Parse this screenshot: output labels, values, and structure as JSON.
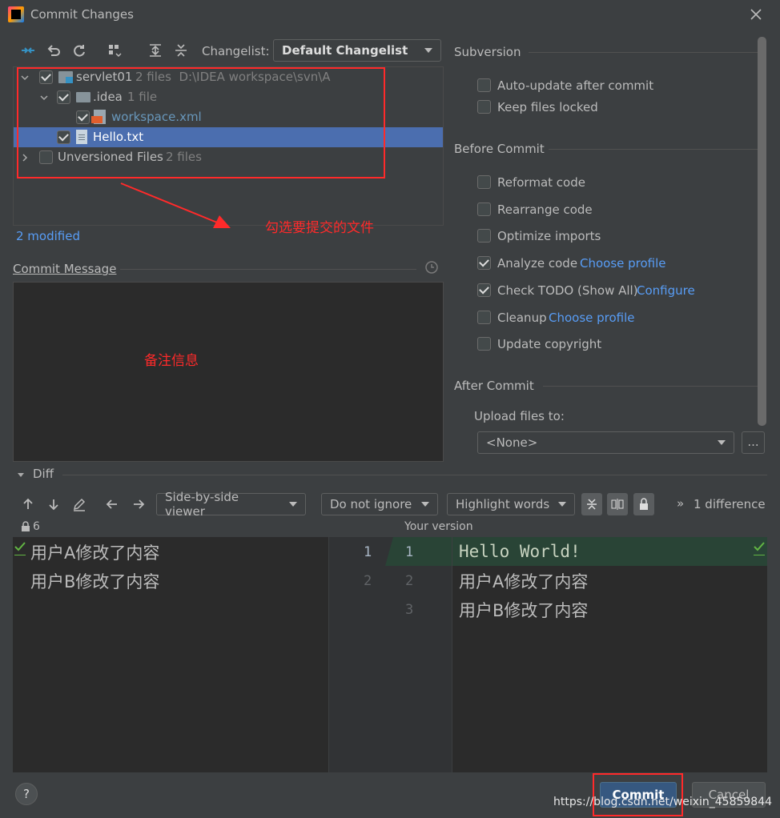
{
  "window": {
    "title": "Commit Changes"
  },
  "toolbar": {
    "changelist_label": "Changelist:",
    "changelist_value": "Default Changelist"
  },
  "tree": {
    "root": {
      "name": "servlet01",
      "meta": "2 files  D:\\IDEA workspace\\svn\\A"
    },
    "idea": {
      "name": ".idea",
      "meta": "1 file"
    },
    "workspace": {
      "name": "workspace.xml"
    },
    "hello": {
      "name": "Hello.txt"
    },
    "unversioned": {
      "name": "Unversioned Files",
      "meta": "2 files"
    }
  },
  "modified_text": "2 modified",
  "annotations": {
    "select_files": "勾选要提交的文件",
    "remark": "备注信息"
  },
  "commit_message": {
    "label": "Commit Message"
  },
  "subversion": {
    "title": "Subversion",
    "auto_update": "Auto-update after commit",
    "keep_locked": "Keep files locked"
  },
  "before_commit": {
    "title": "Before Commit",
    "reformat": "Reformat code",
    "rearrange": "Rearrange code",
    "optimize": "Optimize imports",
    "analyze": "Analyze code",
    "analyze_link": "Choose profile",
    "todo": "Check TODO (Show All)",
    "todo_link": "Configure",
    "cleanup": "Cleanup",
    "cleanup_link": "Choose profile",
    "copyright": "Update copyright"
  },
  "after_commit": {
    "title": "After Commit",
    "upload_label": "Upload files to:",
    "upload_value": "<None>",
    "more_label": "..."
  },
  "diff": {
    "title": "Diff",
    "viewer": "Side-by-side viewer",
    "ignore": "Do not ignore",
    "highlight": "Highlight words",
    "diff_count": "1 difference",
    "more": "»",
    "left_lock_count": "6",
    "right_header": "Your version",
    "left_lines": [
      "用户A修改了内容",
      "用户B修改了内容"
    ],
    "gutter_left": [
      "1",
      "2"
    ],
    "gutter_right": [
      "1",
      "2",
      "3"
    ],
    "right_lines": [
      "Hello World!",
      "用户A修改了内容",
      "用户B修改了内容"
    ]
  },
  "footer": {
    "help": "?",
    "commit": "Commit",
    "cancel": "Cancel",
    "watermark": "https://blog.csdn.net/weixin_45859844"
  },
  "colors": {
    "accent": "#365880",
    "annotation_red": "#ff2a2a",
    "selection": "#4b6eaf",
    "link": "#589df6",
    "added_line": "#294436"
  }
}
